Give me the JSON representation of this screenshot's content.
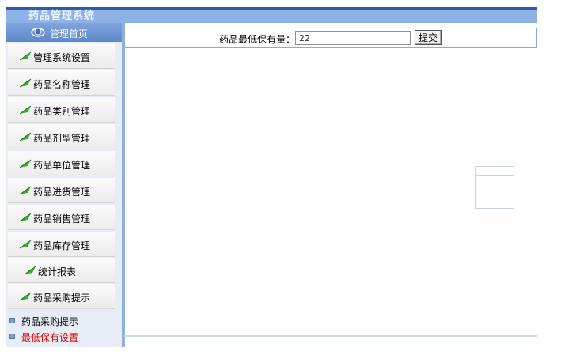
{
  "app": {
    "title": "药品管理系统"
  },
  "sidebar": {
    "home_label": "管理首页",
    "items": [
      {
        "label": "管理系统设置"
      },
      {
        "label": "药品名称管理"
      },
      {
        "label": "药品类别管理"
      },
      {
        "label": "药品剂型管理"
      },
      {
        "label": "药品单位管理"
      },
      {
        "label": "药品进货管理"
      },
      {
        "label": "药品销售管理"
      },
      {
        "label": "药品库存管理"
      },
      {
        "label": "统计报表"
      },
      {
        "label": "药品采购提示"
      }
    ],
    "sub_items": [
      {
        "label": "药品采购提示"
      },
      {
        "label": "最低保有设置"
      }
    ]
  },
  "form": {
    "label": "药品最低保有量：",
    "value": "22",
    "submit_label": "提交"
  },
  "colors": {
    "title_bar": "#2d5aa7",
    "sidebar_bg": "#e6edf7",
    "active_link": "#e00000"
  }
}
